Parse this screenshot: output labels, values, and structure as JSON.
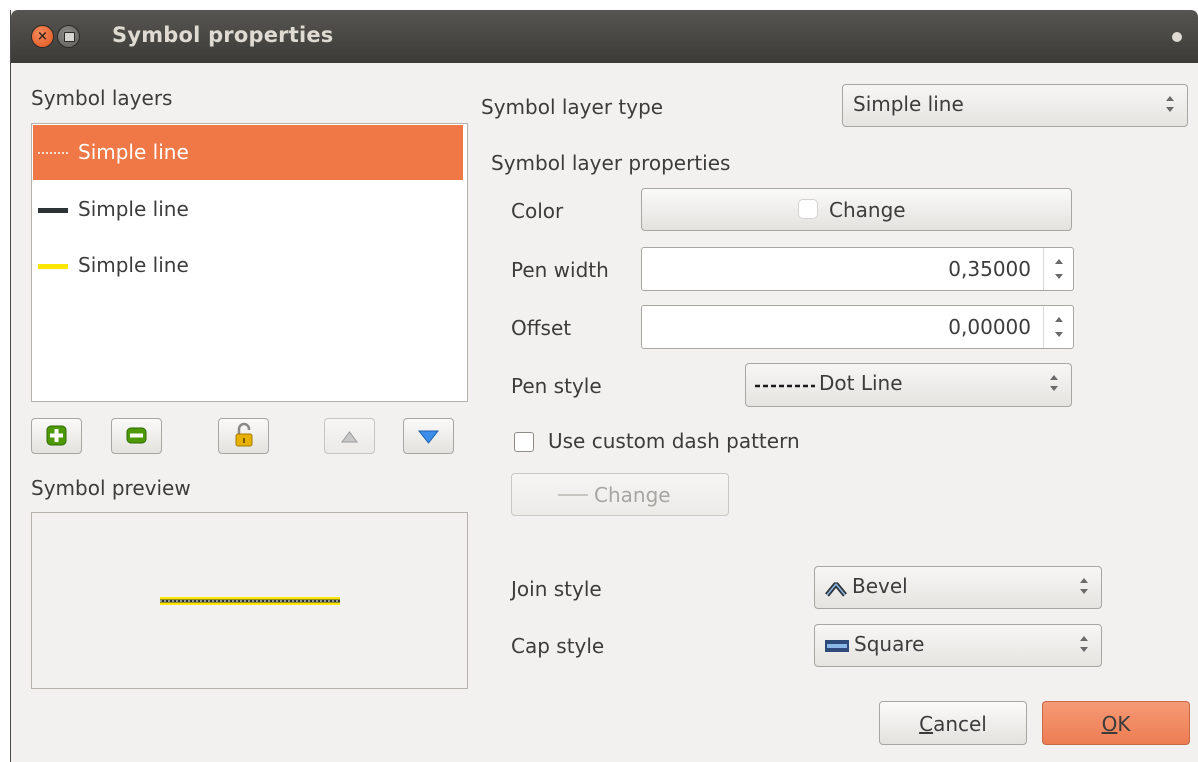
{
  "window": {
    "title": "Symbol properties",
    "close_glyph": "×"
  },
  "layers_panel": {
    "label": "Symbol layers",
    "items": [
      {
        "label": "Simple line",
        "swatch": "dot-line",
        "color": "#ffffff",
        "selected": true
      },
      {
        "label": "Simple line",
        "swatch": "solid-line",
        "color": "#2e3436",
        "selected": false
      },
      {
        "label": "Simple line",
        "swatch": "solid-line",
        "color": "#ffe600",
        "selected": false
      }
    ],
    "buttons": {
      "add": "plus-icon",
      "remove": "minus-icon",
      "lock": "unlocked-padlock-icon",
      "up": "triangle-up-icon",
      "down": "triangle-down-icon"
    }
  },
  "preview": {
    "label": "Symbol preview"
  },
  "layer_type": {
    "label": "Symbol layer type",
    "value": "Simple line"
  },
  "properties": {
    "heading": "Symbol layer properties",
    "color_label": "Color",
    "color_button": "Change",
    "color_value": "#ffffff",
    "pen_width_label": "Pen width",
    "pen_width_value": "0,35000",
    "offset_label": "Offset",
    "offset_value": "0,00000",
    "pen_style_label": "Pen style",
    "pen_style_value": "Dot Line",
    "custom_dash_label": "Use custom dash pattern",
    "custom_dash_checked": false,
    "dash_change_button": "Change",
    "join_style_label": "Join style",
    "join_style_value": "Bevel",
    "cap_style_label": "Cap style",
    "cap_style_value": "Square"
  },
  "footer": {
    "cancel_first": "C",
    "cancel_rest": "ancel",
    "ok_first": "O",
    "ok_rest": "K"
  },
  "colors": {
    "accent": "#f07746",
    "ok_button": "#ee7d52",
    "titlebar": "#3c3b37",
    "preview_line_outer": "#ffe600",
    "preview_line_inner": "#2e3436"
  }
}
